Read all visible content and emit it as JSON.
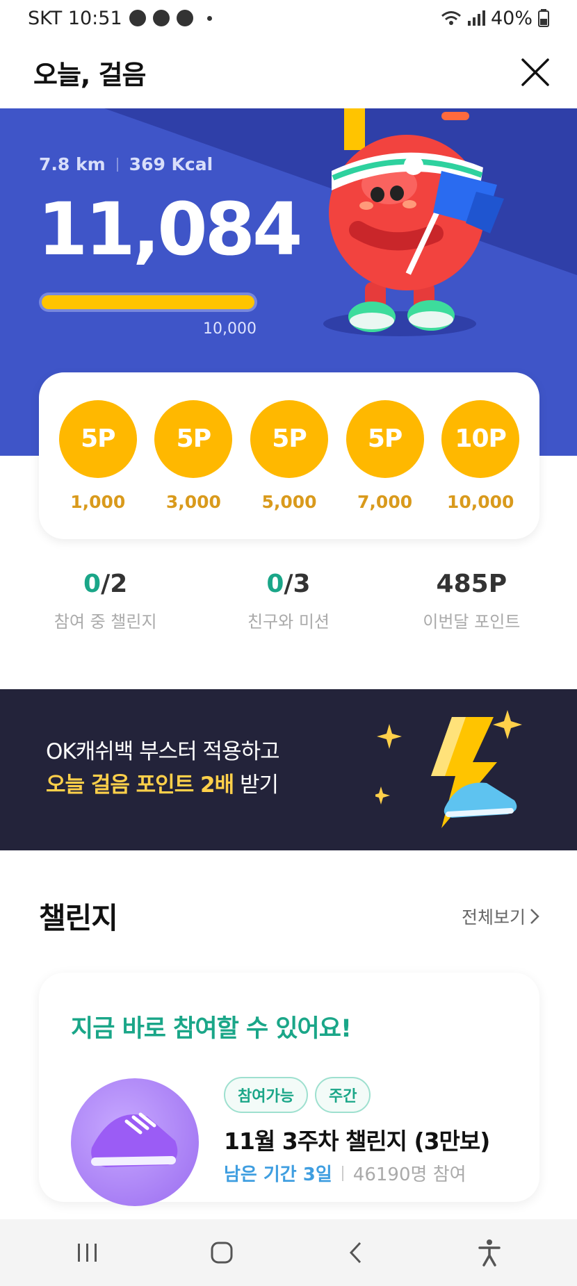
{
  "status": {
    "carrier_time": "SKT 10:51",
    "battery": "40%"
  },
  "header": {
    "title": "오늘, 걸음"
  },
  "hero": {
    "distance": "7.8 km",
    "calories": "369 Kcal",
    "steps": "11,084",
    "goal": "10,000",
    "progress_fraction": 1.0
  },
  "rewards": [
    {
      "points": "5P",
      "steps": "1,000"
    },
    {
      "points": "5P",
      "steps": "3,000"
    },
    {
      "points": "5P",
      "steps": "5,000"
    },
    {
      "points": "5P",
      "steps": "7,000"
    },
    {
      "points": "10P",
      "steps": "10,000"
    }
  ],
  "summary": [
    {
      "done": "0",
      "total": "/2",
      "label": "참여 중 챌린지"
    },
    {
      "done": "0",
      "total": "/3",
      "label": "친구와 미션"
    },
    {
      "value": "485P",
      "label": "이번달 포인트"
    }
  ],
  "banner": {
    "line1": "OK캐쉬백 부스터 적용하고",
    "line2_highlight": "오늘 걸음 포인트 2배",
    "line2_rest": " 받기"
  },
  "challenges": {
    "section_title": "챌린지",
    "view_all": "전체보기",
    "card_headline": "지금 바로 참여할 수 있어요!",
    "tags": [
      "참여가능",
      "주간"
    ],
    "title": "11월 3주차 챌린지 (3만보)",
    "remaining": "남은 기간 3일",
    "participants": "46190명 참여"
  },
  "colors": {
    "hero_bg": "#3f55c8",
    "coin": "#ffb800",
    "accent_green": "#1aa688",
    "banner_bg": "#23233a",
    "progress": "#ffc400"
  }
}
